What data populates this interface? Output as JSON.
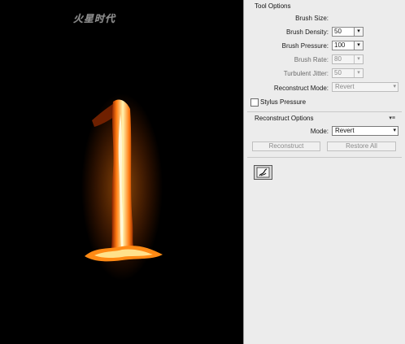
{
  "panel": {
    "tool_options_title": "Tool Options",
    "brush_size_label": "Brush Size:",
    "brush_density_label": "Brush Density:",
    "brush_density_value": "50",
    "brush_pressure_label": "Brush Pressure:",
    "brush_pressure_value": "100",
    "brush_rate_label": "Brush Rate:",
    "brush_rate_value": "80",
    "turbulent_jitter_label": "Turbulent Jitter:",
    "turbulent_jitter_value": "50",
    "reconstruct_mode_label": "Reconstruct Mode:",
    "reconstruct_mode_value": "Revert",
    "stylus_pressure_label": "Stylus Pressure",
    "reconstruct_options_title": "Reconstruct Options",
    "mode_label": "Mode:",
    "mode_value": "Revert",
    "reconstruct_button": "Reconstruct",
    "restore_all_button": "Restore All",
    "watermark": "火星时代"
  },
  "colors": {
    "canvas_bg": "#000000",
    "fire_core": "#fff2a8",
    "fire_mid": "#ff9a1a",
    "fire_outer": "#c23a00"
  },
  "icons": {
    "combo_arrow": "▾",
    "panel_menu": "▾≡"
  }
}
